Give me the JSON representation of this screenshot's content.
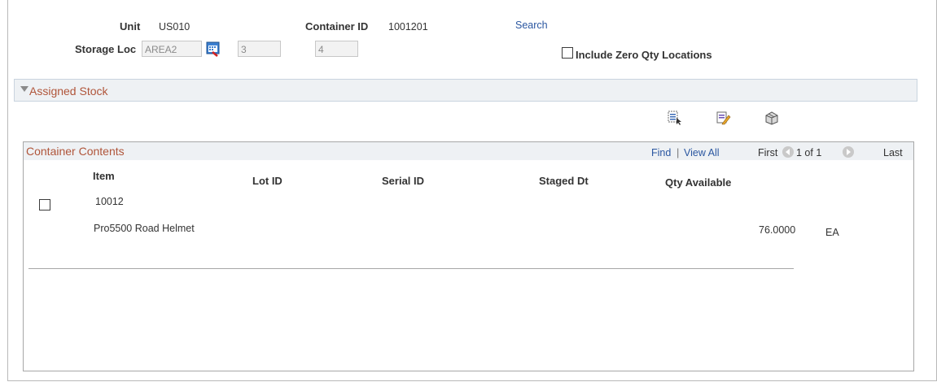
{
  "header": {
    "unit_label": "Unit",
    "unit_value": "US010",
    "container_label": "Container ID",
    "container_value": "1001201",
    "search_link": "Search",
    "storage_label": "Storage Loc",
    "storage_value": "AREA2",
    "storage_level2": "3",
    "storage_level3": "4",
    "zero_qty_label": "Include Zero Qty Locations"
  },
  "section": {
    "title": "Assigned Stock"
  },
  "grid": {
    "title": "Container Contents",
    "find_link": "Find",
    "separator": "|",
    "view_all_link": "View All",
    "first_label": "First",
    "page_info": "1 of 1",
    "last_label": "Last",
    "columns": [
      "Item",
      "Lot ID",
      "Serial ID",
      "Staged Dt",
      "Qty Available"
    ],
    "row": {
      "item": "10012",
      "description": "Pro5500 Road Helmet",
      "qty": "76.0000",
      "uom": "EA"
    }
  },
  "colors": {
    "accent_title": "#b0553a",
    "link": "#2a56a0",
    "section_bg": "#eef1f4"
  },
  "icons": [
    "calendar-lookup-icon",
    "select-all-icon",
    "edit-icon",
    "package-icon",
    "prev-page-icon",
    "next-page-icon",
    "collapse-triangle-icon"
  ]
}
